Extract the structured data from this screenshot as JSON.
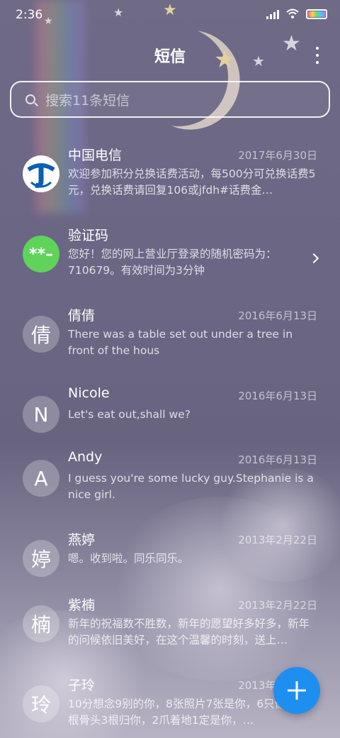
{
  "status_bar": {
    "time": "2:36"
  },
  "header": {
    "title": "短信"
  },
  "search": {
    "placeholder": "搜索11条短信"
  },
  "conversations": [
    {
      "name": "中国电信",
      "date": "2017年6月30日",
      "snippet": "欢迎参加积分兑换话费活动，每500分可兑换话费5元，兑换话费请回复106或jfdh#话费金…",
      "avatar": "telecom-logo"
    },
    {
      "name": "验证码",
      "date": "",
      "snippet": "您好！您的网上营业厅登录的随机密码为：710679。有效时间为3分钟",
      "avatar_text": "**–"
    },
    {
      "name": "倩倩",
      "date": "2016年6月13日",
      "snippet": "There was a table set out under a tree in front of the hous",
      "avatar_text": "倩"
    },
    {
      "name": "Nicole",
      "date": "2016年6月13日",
      "snippet": "Let's eat out,shall we?",
      "avatar_text": "N"
    },
    {
      "name": "Andy",
      "date": "2016年6月13日",
      "snippet": "I guess you're some lucky guy.Stephanie is a nice girl.",
      "avatar_text": "A"
    },
    {
      "name": "燕婷",
      "date": "2013年2月22日",
      "snippet": "嗯。收到啦。同乐同乐。",
      "avatar_text": "婷"
    },
    {
      "name": "紫楠",
      "date": "2013年2月22日",
      "snippet": "新年的祝福数不胜数，新年的愿望好多好多，新年的问候依旧美好，在这个温馨的时刻，送上…",
      "avatar_text": "楠"
    },
    {
      "name": "子玲",
      "date": "2013年2月22日",
      "snippet": "10分想念9别的你，8张照片7张是你，6只像你，4根骨头3根归你，2爪着地1定是你，…",
      "avatar_text": "玲"
    }
  ],
  "colors": {
    "fab": "#1e8ff0",
    "accent_green": "#5fd35a"
  }
}
